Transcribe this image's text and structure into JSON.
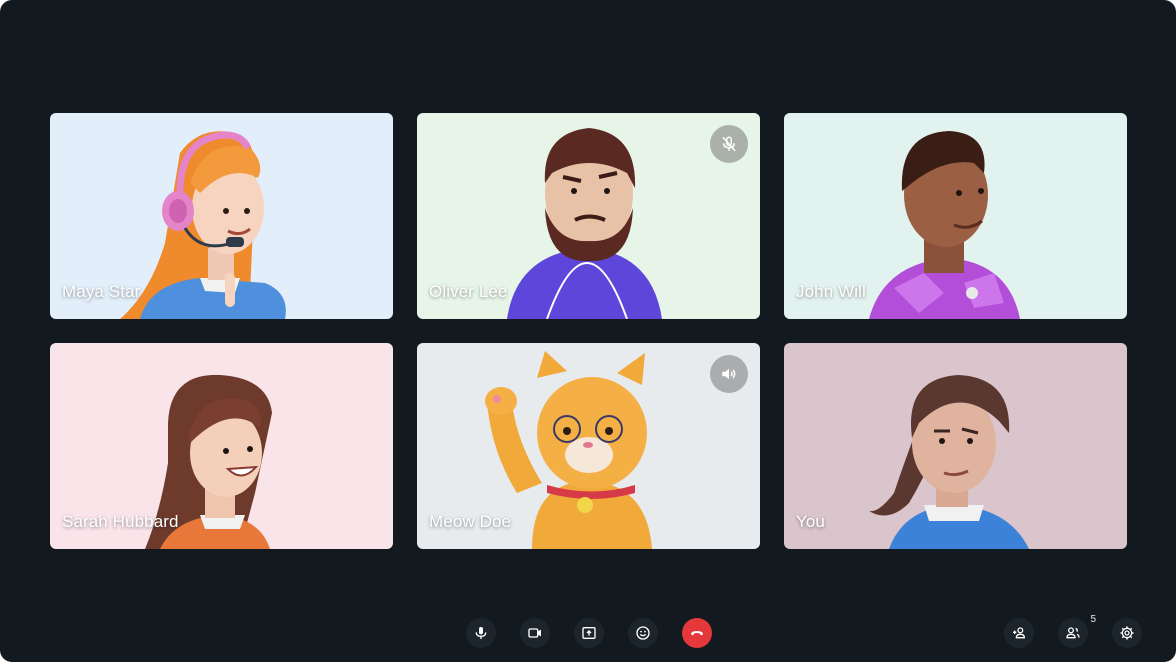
{
  "participants": [
    {
      "name": "Maya Star",
      "bg": "#e2eefa",
      "status_icon": ""
    },
    {
      "name": "Oliver Lee",
      "bg": "#e6f5e8",
      "status_icon": "mic-off-icon"
    },
    {
      "name": "John Will",
      "bg": "#e2f2ef",
      "status_icon": ""
    },
    {
      "name": "Sarah Hubbard",
      "bg": "#f9e4ea",
      "status_icon": ""
    },
    {
      "name": "Meow Doe",
      "bg": "#e7ebee",
      "status_icon": "speaker-icon"
    },
    {
      "name": "You",
      "bg": "#d9c5cb",
      "status_icon": ""
    }
  ],
  "toolbar": {
    "controls": [
      "microphone-icon",
      "camera-icon",
      "present-screen-icon",
      "emoji-icon",
      "end-call-icon"
    ],
    "end_call_color": "#e5383b",
    "right": [
      "add-person-icon",
      "participants-icon",
      "settings-icon"
    ],
    "participant_count": "5"
  },
  "colors": {
    "background": "#121a1f"
  }
}
